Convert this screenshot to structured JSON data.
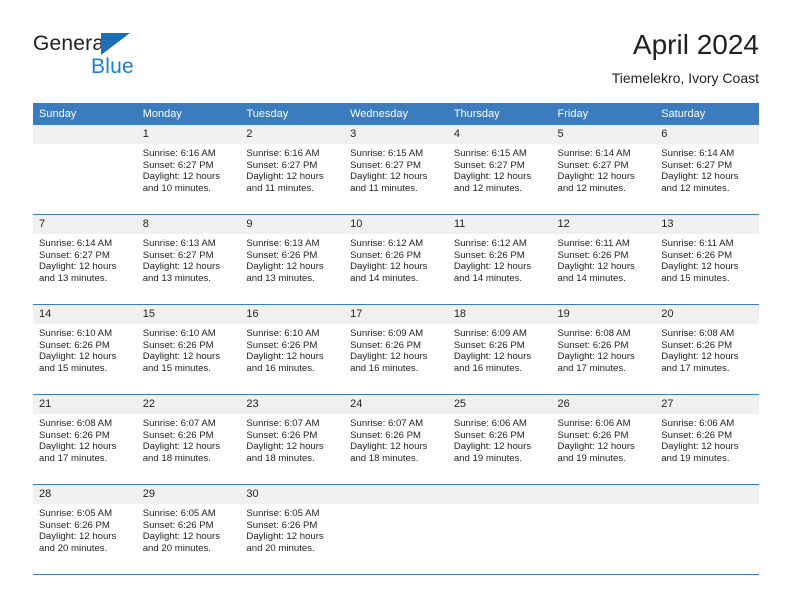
{
  "brand": {
    "word1": "General",
    "word2": "Blue",
    "triangle_color": "#1b6fb4",
    "blue_color": "#1b7fd4"
  },
  "header": {
    "title": "April 2024",
    "subtitle": "Tiemelekro, Ivory Coast"
  },
  "theme": {
    "header_bg": "#3a7cbe",
    "header_text": "#ffffff",
    "daynum_bg": "#f0f0f0",
    "row_divider": "#3a7cbe",
    "text": "#231f20"
  },
  "calendar": {
    "columns": [
      "Sunday",
      "Monday",
      "Tuesday",
      "Wednesday",
      "Thursday",
      "Friday",
      "Saturday"
    ],
    "weeks": [
      [
        {
          "day": "",
          "empty": true,
          "sunrise": "",
          "sunset": "",
          "daylight_1": "",
          "daylight_2": ""
        },
        {
          "day": "1",
          "sunrise": "Sunrise: 6:16 AM",
          "sunset": "Sunset: 6:27 PM",
          "daylight_1": "Daylight: 12 hours",
          "daylight_2": "and 10 minutes."
        },
        {
          "day": "2",
          "sunrise": "Sunrise: 6:16 AM",
          "sunset": "Sunset: 6:27 PM",
          "daylight_1": "Daylight: 12 hours",
          "daylight_2": "and 11 minutes."
        },
        {
          "day": "3",
          "sunrise": "Sunrise: 6:15 AM",
          "sunset": "Sunset: 6:27 PM",
          "daylight_1": "Daylight: 12 hours",
          "daylight_2": "and 11 minutes."
        },
        {
          "day": "4",
          "sunrise": "Sunrise: 6:15 AM",
          "sunset": "Sunset: 6:27 PM",
          "daylight_1": "Daylight: 12 hours",
          "daylight_2": "and 12 minutes."
        },
        {
          "day": "5",
          "sunrise": "Sunrise: 6:14 AM",
          "sunset": "Sunset: 6:27 PM",
          "daylight_1": "Daylight: 12 hours",
          "daylight_2": "and 12 minutes."
        },
        {
          "day": "6",
          "sunrise": "Sunrise: 6:14 AM",
          "sunset": "Sunset: 6:27 PM",
          "daylight_1": "Daylight: 12 hours",
          "daylight_2": "and 12 minutes."
        }
      ],
      [
        {
          "day": "7",
          "sunrise": "Sunrise: 6:14 AM",
          "sunset": "Sunset: 6:27 PM",
          "daylight_1": "Daylight: 12 hours",
          "daylight_2": "and 13 minutes."
        },
        {
          "day": "8",
          "sunrise": "Sunrise: 6:13 AM",
          "sunset": "Sunset: 6:27 PM",
          "daylight_1": "Daylight: 12 hours",
          "daylight_2": "and 13 minutes."
        },
        {
          "day": "9",
          "sunrise": "Sunrise: 6:13 AM",
          "sunset": "Sunset: 6:26 PM",
          "daylight_1": "Daylight: 12 hours",
          "daylight_2": "and 13 minutes."
        },
        {
          "day": "10",
          "sunrise": "Sunrise: 6:12 AM",
          "sunset": "Sunset: 6:26 PM",
          "daylight_1": "Daylight: 12 hours",
          "daylight_2": "and 14 minutes."
        },
        {
          "day": "11",
          "sunrise": "Sunrise: 6:12 AM",
          "sunset": "Sunset: 6:26 PM",
          "daylight_1": "Daylight: 12 hours",
          "daylight_2": "and 14 minutes."
        },
        {
          "day": "12",
          "sunrise": "Sunrise: 6:11 AM",
          "sunset": "Sunset: 6:26 PM",
          "daylight_1": "Daylight: 12 hours",
          "daylight_2": "and 14 minutes."
        },
        {
          "day": "13",
          "sunrise": "Sunrise: 6:11 AM",
          "sunset": "Sunset: 6:26 PM",
          "daylight_1": "Daylight: 12 hours",
          "daylight_2": "and 15 minutes."
        }
      ],
      [
        {
          "day": "14",
          "sunrise": "Sunrise: 6:10 AM",
          "sunset": "Sunset: 6:26 PM",
          "daylight_1": "Daylight: 12 hours",
          "daylight_2": "and 15 minutes."
        },
        {
          "day": "15",
          "sunrise": "Sunrise: 6:10 AM",
          "sunset": "Sunset: 6:26 PM",
          "daylight_1": "Daylight: 12 hours",
          "daylight_2": "and 15 minutes."
        },
        {
          "day": "16",
          "sunrise": "Sunrise: 6:10 AM",
          "sunset": "Sunset: 6:26 PM",
          "daylight_1": "Daylight: 12 hours",
          "daylight_2": "and 16 minutes."
        },
        {
          "day": "17",
          "sunrise": "Sunrise: 6:09 AM",
          "sunset": "Sunset: 6:26 PM",
          "daylight_1": "Daylight: 12 hours",
          "daylight_2": "and 16 minutes."
        },
        {
          "day": "18",
          "sunrise": "Sunrise: 6:09 AM",
          "sunset": "Sunset: 6:26 PM",
          "daylight_1": "Daylight: 12 hours",
          "daylight_2": "and 16 minutes."
        },
        {
          "day": "19",
          "sunrise": "Sunrise: 6:08 AM",
          "sunset": "Sunset: 6:26 PM",
          "daylight_1": "Daylight: 12 hours",
          "daylight_2": "and 17 minutes."
        },
        {
          "day": "20",
          "sunrise": "Sunrise: 6:08 AM",
          "sunset": "Sunset: 6:26 PM",
          "daylight_1": "Daylight: 12 hours",
          "daylight_2": "and 17 minutes."
        }
      ],
      [
        {
          "day": "21",
          "sunrise": "Sunrise: 6:08 AM",
          "sunset": "Sunset: 6:26 PM",
          "daylight_1": "Daylight: 12 hours",
          "daylight_2": "and 17 minutes."
        },
        {
          "day": "22",
          "sunrise": "Sunrise: 6:07 AM",
          "sunset": "Sunset: 6:26 PM",
          "daylight_1": "Daylight: 12 hours",
          "daylight_2": "and 18 minutes."
        },
        {
          "day": "23",
          "sunrise": "Sunrise: 6:07 AM",
          "sunset": "Sunset: 6:26 PM",
          "daylight_1": "Daylight: 12 hours",
          "daylight_2": "and 18 minutes."
        },
        {
          "day": "24",
          "sunrise": "Sunrise: 6:07 AM",
          "sunset": "Sunset: 6:26 PM",
          "daylight_1": "Daylight: 12 hours",
          "daylight_2": "and 18 minutes."
        },
        {
          "day": "25",
          "sunrise": "Sunrise: 6:06 AM",
          "sunset": "Sunset: 6:26 PM",
          "daylight_1": "Daylight: 12 hours",
          "daylight_2": "and 19 minutes."
        },
        {
          "day": "26",
          "sunrise": "Sunrise: 6:06 AM",
          "sunset": "Sunset: 6:26 PM",
          "daylight_1": "Daylight: 12 hours",
          "daylight_2": "and 19 minutes."
        },
        {
          "day": "27",
          "sunrise": "Sunrise: 6:06 AM",
          "sunset": "Sunset: 6:26 PM",
          "daylight_1": "Daylight: 12 hours",
          "daylight_2": "and 19 minutes."
        }
      ],
      [
        {
          "day": "28",
          "sunrise": "Sunrise: 6:05 AM",
          "sunset": "Sunset: 6:26 PM",
          "daylight_1": "Daylight: 12 hours",
          "daylight_2": "and 20 minutes."
        },
        {
          "day": "29",
          "sunrise": "Sunrise: 6:05 AM",
          "sunset": "Sunset: 6:26 PM",
          "daylight_1": "Daylight: 12 hours",
          "daylight_2": "and 20 minutes."
        },
        {
          "day": "30",
          "sunrise": "Sunrise: 6:05 AM",
          "sunset": "Sunset: 6:26 PM",
          "daylight_1": "Daylight: 12 hours",
          "daylight_2": "and 20 minutes."
        },
        {
          "day": "",
          "empty": true,
          "sunrise": "",
          "sunset": "",
          "daylight_1": "",
          "daylight_2": ""
        },
        {
          "day": "",
          "empty": true,
          "sunrise": "",
          "sunset": "",
          "daylight_1": "",
          "daylight_2": ""
        },
        {
          "day": "",
          "empty": true,
          "sunrise": "",
          "sunset": "",
          "daylight_1": "",
          "daylight_2": ""
        },
        {
          "day": "",
          "empty": true,
          "sunrise": "",
          "sunset": "",
          "daylight_1": "",
          "daylight_2": ""
        }
      ]
    ]
  }
}
